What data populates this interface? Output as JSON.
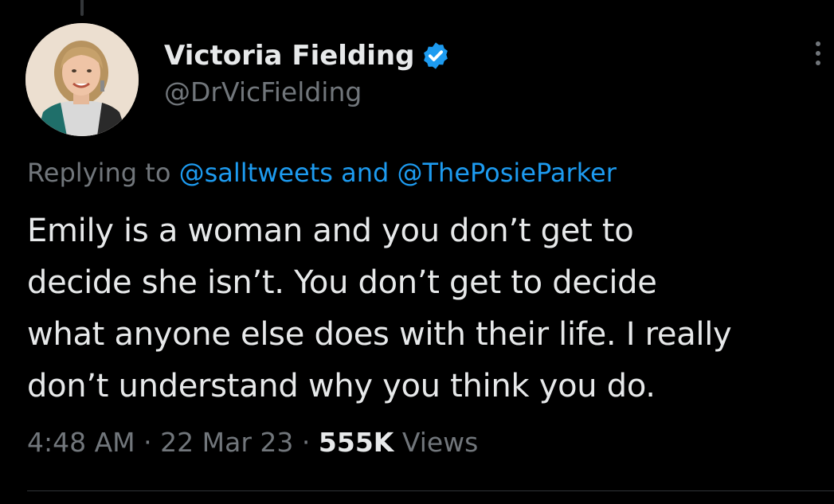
{
  "author": {
    "display_name": "Victoria Fielding",
    "handle": "@DrVicFielding",
    "verified": true
  },
  "reply_context": {
    "prefix": "Replying to",
    "mention_1": "@salltweets",
    "joiner": "and",
    "mention_2": "@ThePosieParker"
  },
  "tweet": {
    "text_lines": [
      "Emily is a woman and you don’t get to",
      "decide she isn’t. You don’t get to decide",
      "what anyone else does with their life. I really",
      "don’t understand why you think you do."
    ]
  },
  "meta": {
    "time": "4:48 AM",
    "sep": "·",
    "date": "22 Mar 23",
    "views_count": "555K",
    "views_label": "Views"
  },
  "icons": {
    "verified": "verified-badge-icon",
    "more": "more-options-icon"
  },
  "colors": {
    "background": "#000000",
    "text": "#e7e9ea",
    "secondary": "#71767b",
    "link": "#1d9bf0"
  }
}
